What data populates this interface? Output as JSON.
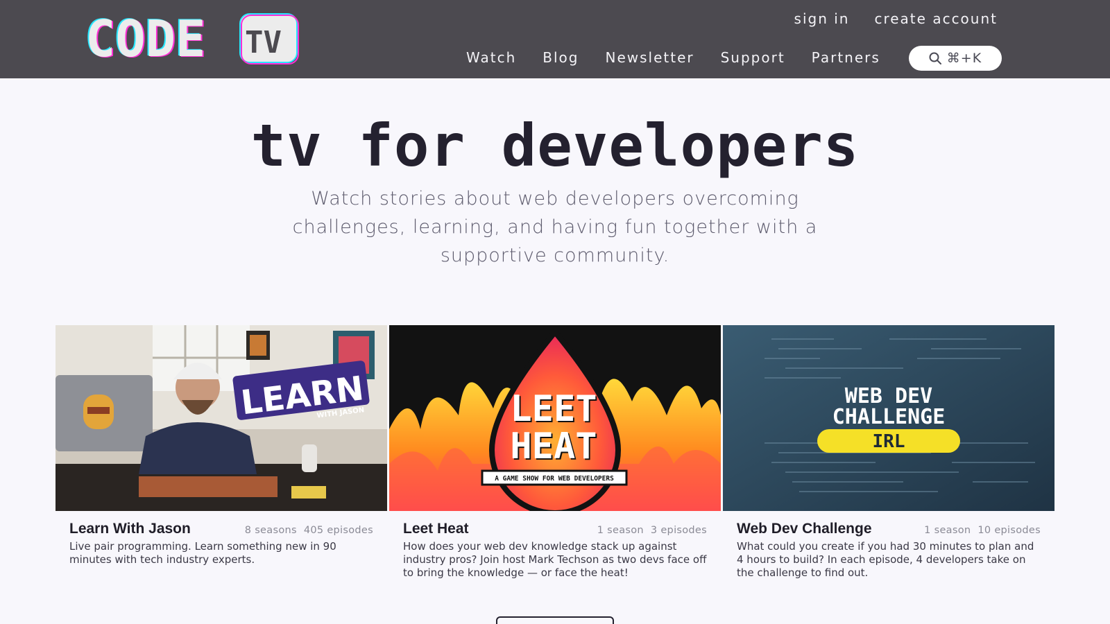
{
  "header": {
    "logo_text": "CODE TV",
    "account_links": [
      "sign in",
      "create account"
    ],
    "nav": [
      "Watch",
      "Blog",
      "Newsletter",
      "Support",
      "Partners"
    ],
    "search_shortcut": "⌘+K",
    "colors": {
      "background": "#4c4a50",
      "text": "#f4f3f7"
    }
  },
  "hero": {
    "title": "tv for developers",
    "subtitle": "Watch stories about web developers overcoming challenges, learning, and having fun together with a supportive community."
  },
  "shows": [
    {
      "title": "Learn With Jason",
      "seasons": "8 seasons",
      "episodes": "405 episodes",
      "description": "Live pair programming. Learn something new in 90 minutes with tech industry experts.",
      "thumbnail_text": "LEARN",
      "thumbnail_subtext": "WITH JASON"
    },
    {
      "title": "Leet Heat",
      "seasons": "1 season",
      "episodes": "3 episodes",
      "description": "How does your web dev knowledge stack up against industry pros? Join host Mark Techson as two devs face off to bring the knowledge — or face the heat!",
      "thumbnail_text_1": "LEET",
      "thumbnail_text_2": "HEAT",
      "thumbnail_subtext": "A GAME SHOW FOR WEB DEVELOPERS"
    },
    {
      "title": "Web Dev Challenge",
      "seasons": "1 season",
      "episodes": "10 episodes",
      "description": "What could you create if you had 30 minutes to plan and 4 hours to build? In each episode, 4 developers take on the challenge to find out.",
      "thumbnail_text_1": "WEB DEV",
      "thumbnail_text_2": "CHALLENGE",
      "thumbnail_badge": "IRL"
    }
  ]
}
